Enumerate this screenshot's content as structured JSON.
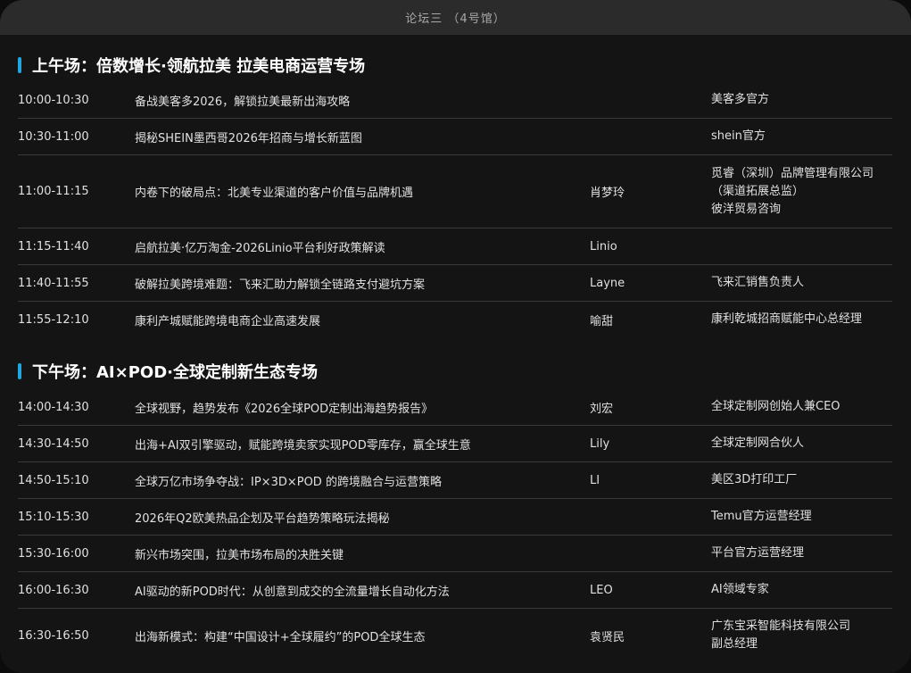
{
  "header": {
    "title": "论坛三 （4号馆）"
  },
  "morning": {
    "title": "上午场：倍数增长·领航拉美  拉美电商运营专场",
    "rows": [
      {
        "time": "10:00-10:30",
        "topic": "备战美客多2026，解锁拉美最新出海攻略",
        "speaker": "",
        "org": "美客多官方"
      },
      {
        "time": "10:30-11:00",
        "topic": "揭秘SHEIN墨西哥2026年招商与增长新蓝图",
        "speaker": "",
        "org": "shein官方"
      },
      {
        "time": "11:00-11:15",
        "topic": "内卷下的破局点：北美专业渠道的客户价值与品牌机遇",
        "speaker": "肖梦玲",
        "org": "觅睿（深圳）品牌管理有限公司\n（渠道拓展总监）\n彼洋贸易咨询"
      },
      {
        "time": "11:15-11:40",
        "topic": "启航拉美·亿万淘金-2026Linio平台利好政策解读",
        "speaker": "Linio",
        "org": ""
      },
      {
        "time": "11:40-11:55",
        "topic": "破解拉美跨境难题：飞来汇助力解锁全链路支付避坑方案",
        "speaker": "Layne",
        "org": "飞来汇销售负责人"
      },
      {
        "time": "11:55-12:10",
        "topic": "康利产城赋能跨境电商企业高速发展",
        "speaker": "喻甜",
        "org": "康利乾城招商赋能中心总经理"
      }
    ]
  },
  "afternoon": {
    "title": "下午场：AI×POD·全球定制新生态专场",
    "rows": [
      {
        "time": "14:00-14:30",
        "topic": "全球视野，趋势发布《2026全球POD定制出海趋势报告》",
        "speaker": "刘宏",
        "org": "全球定制网创始人兼CEO"
      },
      {
        "time": "14:30-14:50",
        "topic": "出海+AI双引擎驱动，赋能跨境卖家实现POD零库存，赢全球生意",
        "speaker": "Lily",
        "org": "全球定制网合伙人"
      },
      {
        "time": "14:50-15:10",
        "topic": "全球万亿市场争夺战：IP×3D×POD 的跨境融合与运营策略",
        "speaker": "LI",
        "org": "美区3D打印工厂"
      },
      {
        "time": "15:10-15:30",
        "topic": "2026年Q2欧美热品企划及平台趋势策略玩法揭秘",
        "speaker": "",
        "org": "Temu官方运营经理"
      },
      {
        "time": "15:30-16:00",
        "topic": "新兴市场突围，拉美市场布局的决胜关键",
        "speaker": "",
        "org": "平台官方运营经理"
      },
      {
        "time": "16:00-16:30",
        "topic": "AI驱动的新POD时代：从创意到成交的全流量增长自动化方法",
        "speaker": "LEO",
        "org": "AI领域专家"
      },
      {
        "time": "16:30-16:50",
        "topic": "出海新模式：构建“中国设计+全球履约”的POD全球生态",
        "speaker": "袁贤民",
        "org": "广东宝采智能科技有限公司\n副总经理"
      }
    ]
  }
}
